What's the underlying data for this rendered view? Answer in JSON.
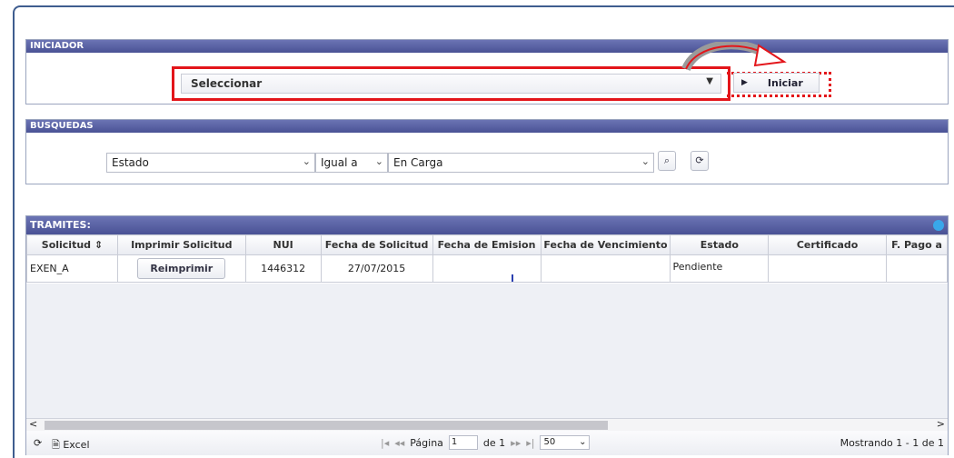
{
  "iniciador": {
    "header": "INICIADOR",
    "select_value": "Seleccionar",
    "caret": "▼",
    "play_icon": "▶",
    "button_label": "Iniciar"
  },
  "busquedas": {
    "header": "BUSQUEDAS",
    "field": "Estado",
    "operator": "Igual a",
    "value": "En Carga",
    "search_icon": "⌕",
    "refresh_icon": "⟳"
  },
  "tramites": {
    "header": "TRAMITES:",
    "columns": [
      "Solicitud ⇕",
      "Imprimir Solicitud",
      "NUI",
      "Fecha de Solicitud",
      "Fecha de Emision",
      "Fecha de Vencimiento",
      "Estado",
      "Certificado",
      "F. Pago a"
    ],
    "row": {
      "solicitud": "EXEN_A",
      "reprint_label": "Reimprimir",
      "nui": "1446312",
      "fecha_solicitud": "27/07/2015",
      "fecha_emision": "",
      "fecha_vencimiento": "",
      "estado": "Pendiente",
      "certificado": "",
      "f_pago": ""
    }
  },
  "pager": {
    "refresh_icon": "⟳",
    "excel_label": "Excel",
    "first_icon": "|◂",
    "prev_icon": "◂◂",
    "page_label": "Página",
    "page_value": "1",
    "of_label": "de 1",
    "next_icon": "▸▸",
    "last_icon": "▸|",
    "rows_per_page": "50",
    "status": "Mostrando 1 - 1 de 1"
  }
}
